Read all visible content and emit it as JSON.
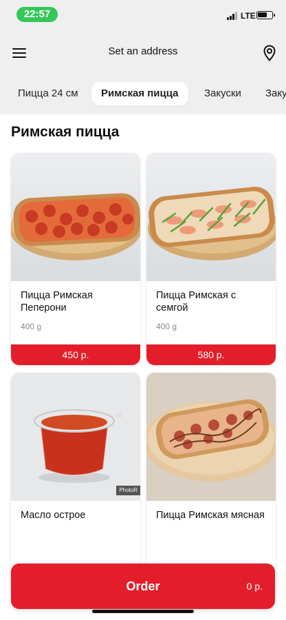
{
  "status_bar": {
    "time": "22:57",
    "network": "LTE",
    "battery_level": 0.7
  },
  "header": {
    "address": "Set an address",
    "menu_icon": "menu-icon",
    "location_icon": "map-pin-icon"
  },
  "tabs": [
    {
      "label": "Пицца 24 см",
      "active": false
    },
    {
      "label": "Римская пицца",
      "active": true
    },
    {
      "label": "Закуски",
      "active": false
    },
    {
      "label": "Заку",
      "active": false
    }
  ],
  "section": {
    "title": "Римская пицца"
  },
  "products": [
    {
      "name": "Пицца Римская Пеперони",
      "weight": "400 g",
      "price": "450 р."
    },
    {
      "name": "Пицца Римская с семгой",
      "weight": "400 g",
      "price": "580 р."
    },
    {
      "name": "Масло острое",
      "watermark": "PhotoR"
    },
    {
      "name": "Пицца Римская мясная"
    }
  ],
  "order": {
    "label": "Order",
    "total": "0 р."
  },
  "colors": {
    "accent": "#e31e2a",
    "status_pill": "#34c759",
    "tab_active_bg": "#ffffff"
  }
}
